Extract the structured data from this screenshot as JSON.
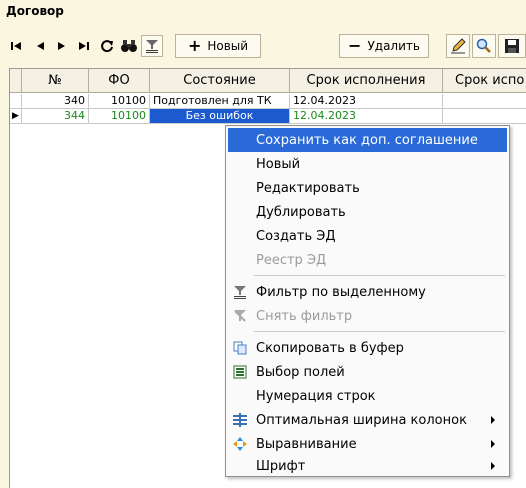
{
  "window": {
    "title": "Договор"
  },
  "toolbar": {
    "new_label": "Новый",
    "delete_label": "Удалить",
    "new_glyph": "+",
    "delete_glyph": "−"
  },
  "grid": {
    "columns": [
      "№",
      "ФО",
      "Состояние",
      "Срок исполнения",
      "Срок испо"
    ],
    "rows": [
      {
        "num": "340",
        "fo": "10100",
        "state": "Подготовлен для ТК",
        "due": "12.04.2023",
        "due2": ""
      },
      {
        "num": "344",
        "fo": "10100",
        "state": "Без ошибок",
        "due": "12.04.2023",
        "due2": ""
      }
    ],
    "current_row_marker": "▶"
  },
  "context_menu": {
    "items": [
      {
        "label": "Сохранить как доп. соглашение",
        "icon": "",
        "disabled": false,
        "highlighted": true,
        "submenu": false
      },
      {
        "label": "Новый",
        "icon": "",
        "disabled": false,
        "highlighted": false,
        "submenu": false
      },
      {
        "label": "Редактировать",
        "icon": "",
        "disabled": false,
        "highlighted": false,
        "submenu": false
      },
      {
        "label": "Дублировать",
        "icon": "",
        "disabled": false,
        "highlighted": false,
        "submenu": false
      },
      {
        "label": "Создать ЭД",
        "icon": "",
        "disabled": false,
        "highlighted": false,
        "submenu": false
      },
      {
        "label": "Реестр ЭД",
        "icon": "",
        "disabled": true,
        "highlighted": false,
        "submenu": false
      },
      {
        "label": "Фильтр по выделенному",
        "icon": "filter-icon",
        "disabled": false,
        "highlighted": false,
        "submenu": false
      },
      {
        "label": "Снять фильтр",
        "icon": "remove-filter-icon",
        "disabled": true,
        "highlighted": false,
        "submenu": false
      },
      {
        "label": "Скопировать в буфер",
        "icon": "copy-icon",
        "disabled": false,
        "highlighted": false,
        "submenu": false
      },
      {
        "label": "Выбор полей",
        "icon": "fields-icon",
        "disabled": false,
        "highlighted": false,
        "submenu": false
      },
      {
        "label": "Нумерация строк",
        "icon": "",
        "disabled": false,
        "highlighted": false,
        "submenu": false
      },
      {
        "label": "Оптимальная ширина колонок",
        "icon": "column-width-icon",
        "disabled": false,
        "highlighted": false,
        "submenu": true
      },
      {
        "label": "Выравнивание",
        "icon": "align-icon",
        "disabled": false,
        "highlighted": false,
        "submenu": true
      },
      {
        "label": "Шрифт",
        "icon": "",
        "disabled": false,
        "highlighted": false,
        "submenu": true
      }
    ]
  },
  "colors": {
    "background": "#fbf6e0",
    "selection": "#1c5bcf",
    "menu_highlight": "#2a6ad8",
    "green_row_text": "#1a8a1a",
    "disabled_text": "#9b9b9b"
  }
}
